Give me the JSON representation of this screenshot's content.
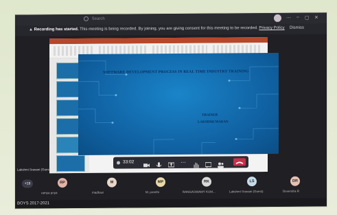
{
  "topbar": {
    "search_placeholder": "Search"
  },
  "banner": {
    "lead": "Recording has started.",
    "text": " This meeting is being recorded. By joining, you are giving consent for this meeting to be recorded.",
    "link": "Privacy Policy",
    "dismiss": "Dismiss"
  },
  "slide": {
    "title": "SOFTWARE DEVELOPMENT PROCESS IN REAL TIME INDUSTRY TRAINING",
    "trainer_label": "TRAINER",
    "trainer_name": "LAKSHMI MADAN"
  },
  "toolbar": {
    "time": "33:02"
  },
  "presenter": {
    "label": "Lakshmi Sravani (Guest)"
  },
  "participants": {
    "more": "+19",
    "people": [
      {
        "initials": "RP",
        "name": "ramya priya",
        "color": "#e2b3a6"
      },
      {
        "initials": "M",
        "name": "madhavi",
        "color": "#e8d6c9"
      },
      {
        "initials": "MP",
        "name": "M. preethi",
        "color": "#ead9a6"
      },
      {
        "initials": "RK",
        "name": "RANGASWAMY KUM...",
        "color": "#d9d9d9"
      },
      {
        "initials": "LS",
        "name": "Lakshmi Sravani (Guest)",
        "color": "#c5dbea"
      },
      {
        "initials": "DR",
        "name": "Devendra R",
        "color": "#e6c0b3"
      }
    ]
  },
  "taskbar": {
    "left_text": "BOYS 2017-2021"
  }
}
